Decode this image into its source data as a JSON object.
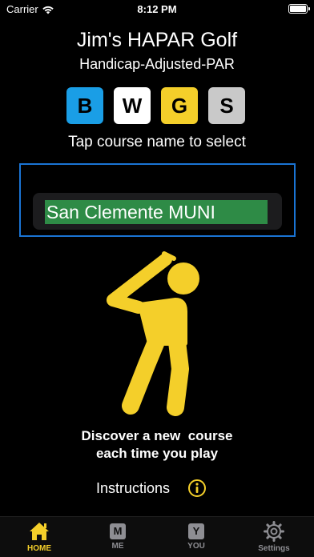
{
  "status_bar": {
    "carrier": "Carrier",
    "time": "8:12 PM"
  },
  "header": {
    "title": "Jim's HAPAR Golf",
    "subtitle": "Handicap-Adjusted-PAR"
  },
  "tees": [
    {
      "label": "B",
      "color": "#1a9ee6"
    },
    {
      "label": "W",
      "color": "#ffffff"
    },
    {
      "label": "G",
      "color": "#f4cf2a"
    },
    {
      "label": "S",
      "color": "#c9c9c9"
    }
  ],
  "instruction": "Tap course name to select",
  "course": {
    "name": "San Clemente MUNI",
    "highlight_color": "#2e8b46"
  },
  "tagline": {
    "line1": "Discover a new  course",
    "line2": "each time you play"
  },
  "instructions_link": {
    "label": "Instructions",
    "icon": "info-circle-icon"
  },
  "tabs": [
    {
      "label": "HOME",
      "icon": "house-icon",
      "active": true
    },
    {
      "label": "ME",
      "icon": "m-box-icon",
      "letter": "M",
      "active": false
    },
    {
      "label": "YOU",
      "icon": "y-box-icon",
      "letter": "Y",
      "active": false
    },
    {
      "label": "Settings",
      "icon": "gear-icon",
      "active": false
    }
  ],
  "colors": {
    "accent": "#f4cf2a",
    "frame": "#1a74d4",
    "inactive": "#8e8e93"
  }
}
